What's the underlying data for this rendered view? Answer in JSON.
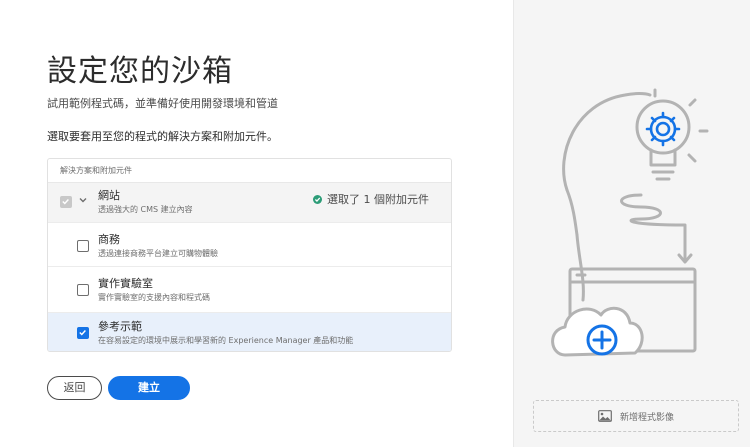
{
  "page": {
    "title": "設定您的沙箱",
    "subtitle": "試用範例程式碼，並準備好使用開發環境和管道",
    "prompt": "選取要套用至您的程式的解決方案和附加元件。"
  },
  "panel": {
    "header": "解決方案和附加元件",
    "items": [
      {
        "title": "網站",
        "description": "透過強大的 CMS 建立內容",
        "checked": true,
        "disabled": true,
        "expandable": true,
        "status": "選取了 1 個附加元件"
      },
      {
        "title": "商務",
        "description": "透過連接商務平台建立可購物體驗",
        "checked": false
      },
      {
        "title": "實作實驗室",
        "description": "實作實驗室的支援內容和程式碼",
        "checked": false
      },
      {
        "title": "參考示範",
        "description": "在容易設定的環境中展示和學習新的 Experience Manager 產品和功能",
        "checked": true
      }
    ]
  },
  "buttons": {
    "back": "返回",
    "create": "建立"
  },
  "sidebar": {
    "add_image": "新增程式影像"
  },
  "colors": {
    "accent": "#1473e6",
    "success": "#2d9d78",
    "illustration_stroke": "#b3b3b3"
  }
}
